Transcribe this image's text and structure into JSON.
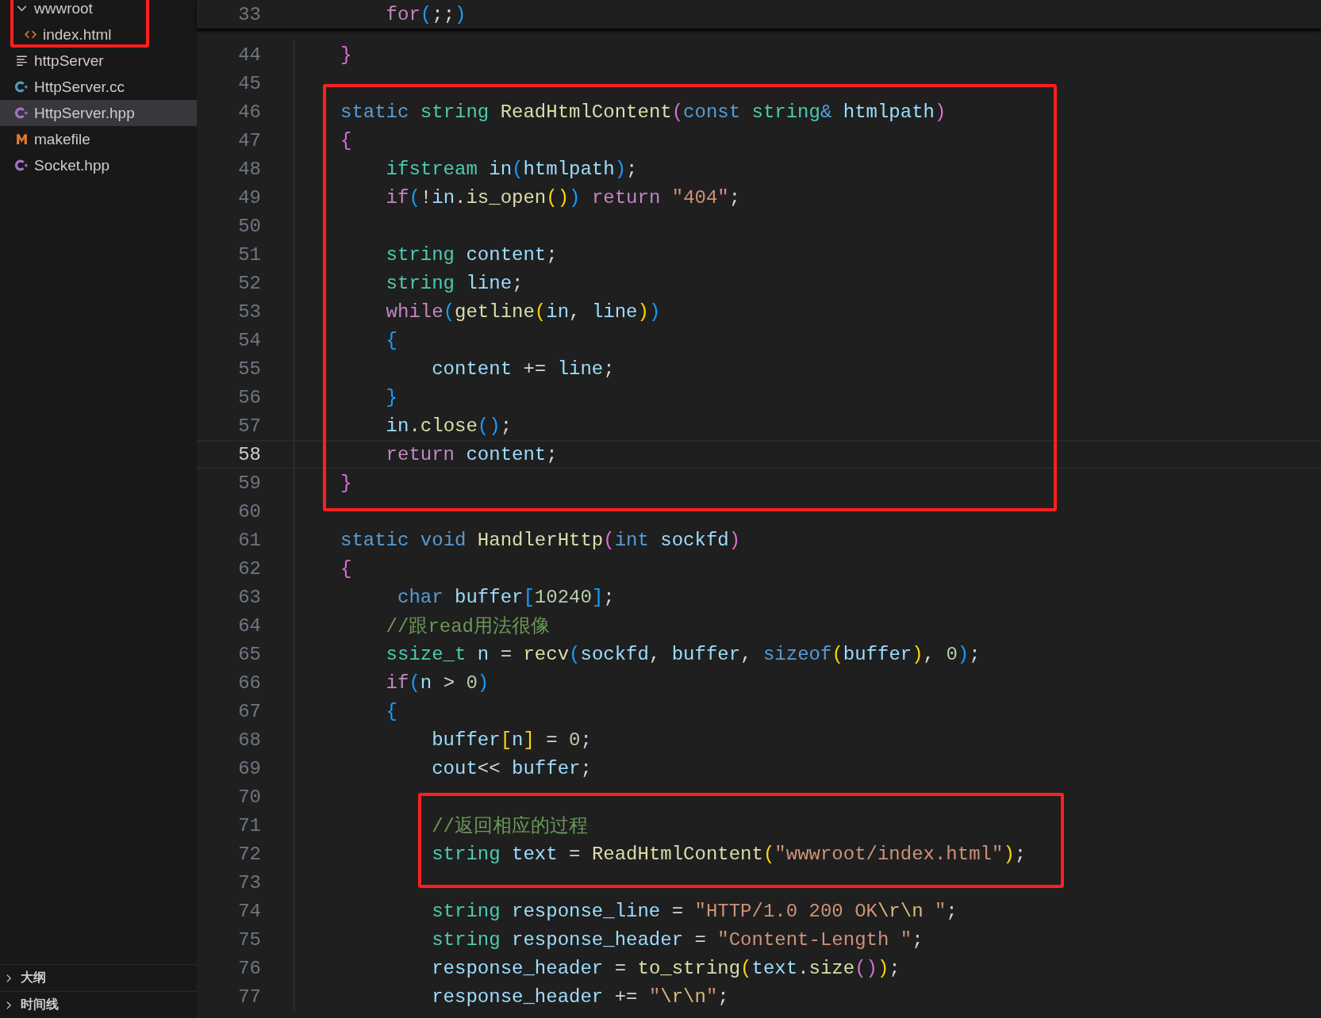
{
  "explorer": {
    "items": [
      {
        "kind": "box",
        "items": [
          {
            "kind": "folder",
            "label": "wwwroot",
            "expanded": true,
            "selected": false
          },
          {
            "kind": "file",
            "label": "index.html",
            "selected": false
          }
        ]
      },
      {
        "kind": "file",
        "label": "httpServer",
        "selected": false
      },
      {
        "kind": "file",
        "label": "HttpServer.cc",
        "selected": false
      },
      {
        "kind": "file",
        "label": "HttpServer.hpp",
        "selected": true
      },
      {
        "kind": "file",
        "label": "makefile",
        "selected": false
      },
      {
        "kind": "file",
        "label": "Socket.hpp",
        "selected": false
      }
    ],
    "sections": [
      {
        "label": "大纲",
        "expanded": false
      },
      {
        "label": "时间线",
        "expanded": false
      }
    ]
  },
  "editor": {
    "sticky_line": {
      "number": "33",
      "tokens": [
        {
          "text": "    for",
          "kind": "ctl"
        },
        {
          "text": "(",
          "kind": "b3"
        },
        {
          "text": ";;",
          "kind": "punc"
        },
        {
          "text": ")",
          "kind": "b3"
        }
      ]
    },
    "lines": [
      {
        "kind": "line",
        "number": "44",
        "current": false,
        "tokens": [
          {
            "text": "}",
            "kind": "b2"
          }
        ]
      },
      {
        "kind": "line",
        "number": "45",
        "current": false
      },
      {
        "kind": "box",
        "lines": [
          {
            "number": "46",
            "current": false,
            "tokens": [
              {
                "text": "static",
                "kind": "kw"
              },
              {
                "text": " string",
                "kind": "type"
              },
              {
                "text": " ReadHtmlContent",
                "kind": "fn"
              },
              {
                "text": "(",
                "kind": "b2"
              },
              {
                "text": "const",
                "kind": "kw"
              },
              {
                "text": " string",
                "kind": "type"
              },
              {
                "text": "&",
                "kind": "kw"
              },
              {
                "text": " htmlpath",
                "kind": "var"
              },
              {
                "text": ")",
                "kind": "b2"
              }
            ]
          },
          {
            "number": "47",
            "current": false,
            "tokens": [
              {
                "text": "{",
                "kind": "b2"
              }
            ]
          },
          {
            "number": "48",
            "current": false,
            "tokens": [
              {
                "text": "    ifstream",
                "kind": "type"
              },
              {
                "text": " in",
                "kind": "var"
              },
              {
                "text": "(",
                "kind": "b3"
              },
              {
                "text": "htmlpath",
                "kind": "var"
              },
              {
                "text": ")",
                "kind": "b3"
              },
              {
                "text": ";",
                "kind": "punc"
              }
            ]
          },
          {
            "number": "49",
            "current": false,
            "tokens": [
              {
                "text": "    if",
                "kind": "ctl"
              },
              {
                "text": "(",
                "kind": "b3"
              },
              {
                "text": "!",
                "kind": "punc"
              },
              {
                "text": "in",
                "kind": "var"
              },
              {
                "text": ".",
                "kind": "punc"
              },
              {
                "text": "is_open",
                "kind": "fn"
              },
              {
                "text": "()",
                "kind": "b1"
              },
              {
                "text": ")",
                "kind": "b3"
              },
              {
                "text": " return",
                "kind": "ctl"
              },
              {
                "text": " \"404\"",
                "kind": "str"
              },
              {
                "text": ";",
                "kind": "punc"
              }
            ]
          },
          {
            "number": "50",
            "current": false
          },
          {
            "number": "51",
            "current": false,
            "tokens": [
              {
                "text": "    string",
                "kind": "type"
              },
              {
                "text": " content",
                "kind": "var"
              },
              {
                "text": ";",
                "kind": "punc"
              }
            ]
          },
          {
            "number": "52",
            "current": false,
            "tokens": [
              {
                "text": "    string",
                "kind": "type"
              },
              {
                "text": " line",
                "kind": "var"
              },
              {
                "text": ";",
                "kind": "punc"
              }
            ]
          },
          {
            "number": "53",
            "current": false,
            "tokens": [
              {
                "text": "    while",
                "kind": "ctl"
              },
              {
                "text": "(",
                "kind": "b3"
              },
              {
                "text": "getline",
                "kind": "fn"
              },
              {
                "text": "(",
                "kind": "b1"
              },
              {
                "text": "in",
                "kind": "var"
              },
              {
                "text": ", ",
                "kind": "punc"
              },
              {
                "text": "line",
                "kind": "var"
              },
              {
                "text": ")",
                "kind": "b1"
              },
              {
                "text": ")",
                "kind": "b3"
              }
            ]
          },
          {
            "number": "54",
            "current": false,
            "tokens": [
              {
                "text": "    {",
                "kind": "b3"
              }
            ]
          },
          {
            "number": "55",
            "current": false,
            "tokens": [
              {
                "text": "        content",
                "kind": "var"
              },
              {
                "text": " += ",
                "kind": "punc"
              },
              {
                "text": "line",
                "kind": "var"
              },
              {
                "text": ";",
                "kind": "punc"
              }
            ]
          },
          {
            "number": "56",
            "current": false,
            "tokens": [
              {
                "text": "    }",
                "kind": "b3"
              }
            ]
          },
          {
            "number": "57",
            "current": false,
            "tokens": [
              {
                "text": "    in",
                "kind": "var"
              },
              {
                "text": ".",
                "kind": "punc"
              },
              {
                "text": "close",
                "kind": "fn"
              },
              {
                "text": "()",
                "kind": "b3"
              },
              {
                "text": ";",
                "kind": "punc"
              }
            ]
          },
          {
            "number": "58",
            "current": true,
            "tokens": [
              {
                "text": "    return",
                "kind": "ctl"
              },
              {
                "text": " content",
                "kind": "var"
              },
              {
                "text": ";",
                "kind": "punc"
              }
            ]
          },
          {
            "number": "59",
            "current": false,
            "tokens": [
              {
                "text": "}",
                "kind": "b2"
              }
            ]
          }
        ]
      },
      {
        "kind": "line",
        "number": "60",
        "current": false
      },
      {
        "kind": "line",
        "number": "61",
        "current": false,
        "tokens": [
          {
            "text": "static",
            "kind": "kw"
          },
          {
            "text": " void",
            "kind": "kw"
          },
          {
            "text": " HandlerHttp",
            "kind": "fn"
          },
          {
            "text": "(",
            "kind": "b2"
          },
          {
            "text": "int",
            "kind": "kw"
          },
          {
            "text": " sockfd",
            "kind": "var"
          },
          {
            "text": ")",
            "kind": "b2"
          }
        ]
      },
      {
        "kind": "line",
        "number": "62",
        "current": false,
        "tokens": [
          {
            "text": "{",
            "kind": "b2"
          }
        ]
      },
      {
        "kind": "line",
        "number": "63",
        "current": false,
        "tokens": [
          {
            "text": "     char",
            "kind": "kw"
          },
          {
            "text": " buffer",
            "kind": "var"
          },
          {
            "text": "[",
            "kind": "b3"
          },
          {
            "text": "10240",
            "kind": "num"
          },
          {
            "text": "]",
            "kind": "b3"
          },
          {
            "text": ";",
            "kind": "punc"
          }
        ]
      },
      {
        "kind": "line",
        "number": "64",
        "current": false,
        "tokens": [
          {
            "text": "    //跟read用法很像",
            "kind": "cmt"
          }
        ]
      },
      {
        "kind": "line",
        "number": "65",
        "current": false,
        "tokens": [
          {
            "text": "    ssize_t",
            "kind": "type"
          },
          {
            "text": " n",
            "kind": "var"
          },
          {
            "text": " = ",
            "kind": "punc"
          },
          {
            "text": "recv",
            "kind": "fn"
          },
          {
            "text": "(",
            "kind": "b3"
          },
          {
            "text": "sockfd",
            "kind": "var"
          },
          {
            "text": ", ",
            "kind": "punc"
          },
          {
            "text": "buffer",
            "kind": "var"
          },
          {
            "text": ", ",
            "kind": "punc"
          },
          {
            "text": "sizeof",
            "kind": "kw"
          },
          {
            "text": "(",
            "kind": "b1"
          },
          {
            "text": "buffer",
            "kind": "var"
          },
          {
            "text": ")",
            "kind": "b1"
          },
          {
            "text": ", ",
            "kind": "punc"
          },
          {
            "text": "0",
            "kind": "num"
          },
          {
            "text": ")",
            "kind": "b3"
          },
          {
            "text": ";",
            "kind": "punc"
          }
        ]
      },
      {
        "kind": "line",
        "number": "66",
        "current": false,
        "tokens": [
          {
            "text": "    if",
            "kind": "ctl"
          },
          {
            "text": "(",
            "kind": "b3"
          },
          {
            "text": "n",
            "kind": "var"
          },
          {
            "text": " > ",
            "kind": "punc"
          },
          {
            "text": "0",
            "kind": "num"
          },
          {
            "text": ")",
            "kind": "b3"
          }
        ]
      },
      {
        "kind": "line",
        "number": "67",
        "current": false,
        "tokens": [
          {
            "text": "    {",
            "kind": "b3"
          }
        ]
      },
      {
        "kind": "line",
        "number": "68",
        "current": false,
        "tokens": [
          {
            "text": "        buffer",
            "kind": "var"
          },
          {
            "text": "[",
            "kind": "b1"
          },
          {
            "text": "n",
            "kind": "var"
          },
          {
            "text": "]",
            "kind": "b1"
          },
          {
            "text": " = ",
            "kind": "punc"
          },
          {
            "text": "0",
            "kind": "num"
          },
          {
            "text": ";",
            "kind": "punc"
          }
        ]
      },
      {
        "kind": "line",
        "number": "69",
        "current": false,
        "tokens": [
          {
            "text": "        cout",
            "kind": "var"
          },
          {
            "text": "<< ",
            "kind": "punc"
          },
          {
            "text": "buffer",
            "kind": "var"
          },
          {
            "text": ";",
            "kind": "punc"
          }
        ]
      },
      {
        "kind": "line",
        "number": "70",
        "current": false
      },
      {
        "kind": "box",
        "lines": [
          {
            "number": "71",
            "current": false,
            "tokens": [
              {
                "text": "        //返回相应的过程",
                "kind": "cmt"
              }
            ]
          },
          {
            "number": "72",
            "current": false,
            "tokens": [
              {
                "text": "        string",
                "kind": "type"
              },
              {
                "text": " text",
                "kind": "var"
              },
              {
                "text": " = ",
                "kind": "punc"
              },
              {
                "text": "ReadHtmlContent",
                "kind": "fn"
              },
              {
                "text": "(",
                "kind": "b1"
              },
              {
                "text": "\"wwwroot/index.html\"",
                "kind": "str"
              },
              {
                "text": ")",
                "kind": "b1"
              },
              {
                "text": ";",
                "kind": "punc"
              }
            ]
          }
        ]
      },
      {
        "kind": "line",
        "number": "73",
        "current": false
      },
      {
        "kind": "line",
        "number": "74",
        "current": false,
        "tokens": [
          {
            "text": "        string",
            "kind": "type"
          },
          {
            "text": " response_line",
            "kind": "var"
          },
          {
            "text": " = ",
            "kind": "punc"
          },
          {
            "text": "\"HTTP/1.0 200 OK",
            "kind": "str"
          },
          {
            "text": "\\r\\n",
            "kind": "esc"
          },
          {
            "text": " \"",
            "kind": "str"
          },
          {
            "text": ";",
            "kind": "punc"
          }
        ]
      },
      {
        "kind": "line",
        "number": "75",
        "current": false,
        "tokens": [
          {
            "text": "        string",
            "kind": "type"
          },
          {
            "text": " response_header",
            "kind": "var"
          },
          {
            "text": " = ",
            "kind": "punc"
          },
          {
            "text": "\"Content-Length \"",
            "kind": "str"
          },
          {
            "text": ";",
            "kind": "punc"
          }
        ]
      },
      {
        "kind": "line",
        "number": "76",
        "current": false,
        "tokens": [
          {
            "text": "        response_header",
            "kind": "var"
          },
          {
            "text": " = ",
            "kind": "punc"
          },
          {
            "text": "to_string",
            "kind": "fn"
          },
          {
            "text": "(",
            "kind": "b1"
          },
          {
            "text": "text",
            "kind": "var"
          },
          {
            "text": ".",
            "kind": "punc"
          },
          {
            "text": "size",
            "kind": "fn"
          },
          {
            "text": "()",
            "kind": "b2"
          },
          {
            "text": ")",
            "kind": "b1"
          },
          {
            "text": ";",
            "kind": "punc"
          }
        ]
      },
      {
        "kind": "line",
        "number": "77",
        "current": false,
        "tokens": [
          {
            "text": "        response_header",
            "kind": "var"
          },
          {
            "text": " += ",
            "kind": "punc"
          },
          {
            "text": "\"",
            "kind": "str"
          },
          {
            "text": "\\r\\n",
            "kind": "esc"
          },
          {
            "text": "\"",
            "kind": "str"
          },
          {
            "text": ";",
            "kind": "punc"
          }
        ]
      }
    ]
  }
}
